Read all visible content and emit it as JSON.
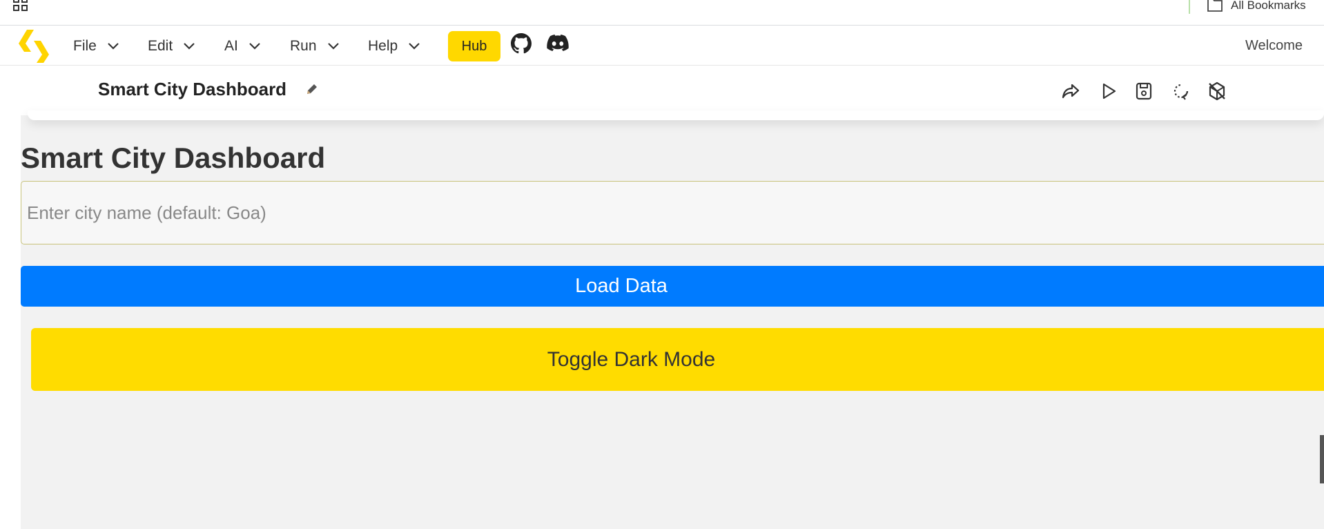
{
  "browser": {
    "bookmarks_label": "All Bookmarks"
  },
  "menubar": {
    "items": [
      {
        "label": "File",
        "icon": "chevron-down-icon"
      },
      {
        "label": "Edit",
        "icon": "chevron-down-icon"
      },
      {
        "label": "AI",
        "icon": "chevron-down-icon"
      },
      {
        "label": "Run",
        "icon": "chevron-down-icon"
      },
      {
        "label": "Help",
        "icon": "chevron-down-icon"
      }
    ],
    "hub_label": "Hub",
    "icons": [
      "github-icon",
      "discord-icon"
    ],
    "welcome": "Welcome",
    "accent_color": "#ffd800"
  },
  "project": {
    "title": "Smart City Dashboard",
    "toolbar_icons": [
      "share-icon",
      "run-icon",
      "save-icon",
      "refresh-icon",
      "package-off-icon"
    ]
  },
  "preview": {
    "heading": "Smart City Dashboard",
    "city_input": {
      "placeholder": "Enter city name (default: Goa)",
      "value": ""
    },
    "load_button": "Load Data",
    "load_button_color": "#007bff",
    "toggle_button": "Toggle Dark Mode",
    "toggle_button_color": "#ffdc00"
  }
}
